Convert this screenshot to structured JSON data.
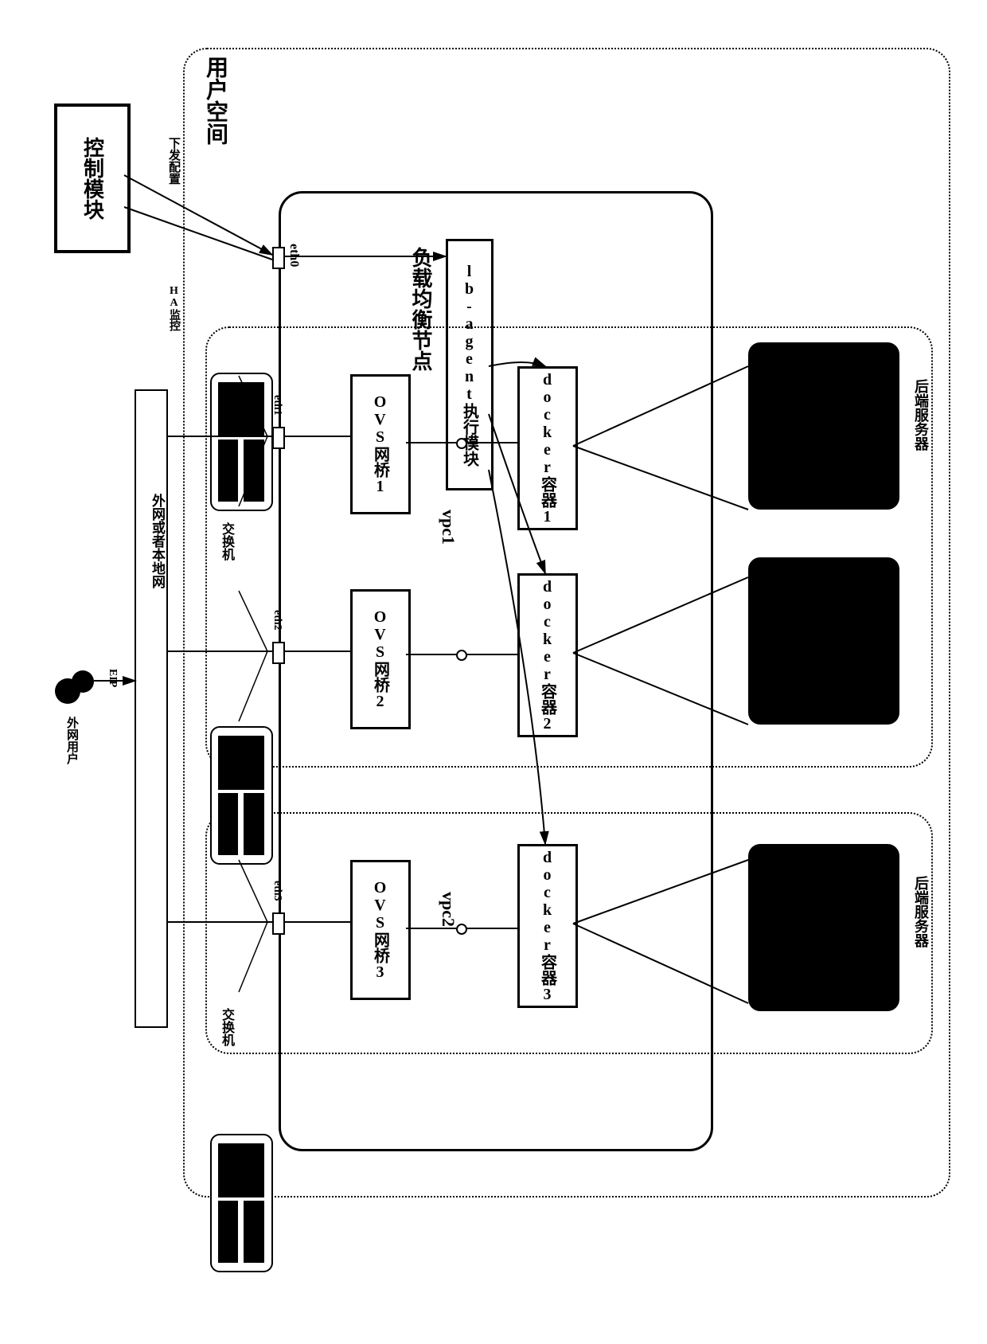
{
  "external_user": "外网用户",
  "eip": "EIP",
  "control_module": "控制模块",
  "deliver_config": "下发配置",
  "ha_monitor": "HA监控",
  "user_space": "用户空间",
  "internet_conn": "外网或者本地网",
  "load_balance_node": "负载均衡节点",
  "lb_agent": "lb-agent执行模块",
  "eth": [
    "eth0",
    "eth1",
    "eth2",
    "eth3"
  ],
  "ovs_bridge": [
    "OVS网桥1",
    "OVS网桥2",
    "OVS网桥3"
  ],
  "docker_container": [
    "docker容器1",
    "docker容器2",
    "docker容器3"
  ],
  "vpc": [
    "vpc1",
    "vpc2"
  ],
  "switch": "交换机",
  "backend_server": "后端服务器"
}
